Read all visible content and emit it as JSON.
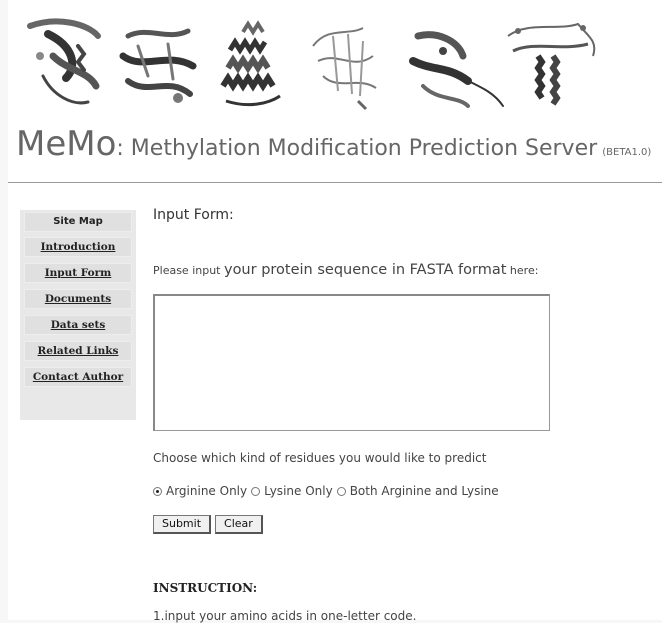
{
  "header": {
    "logo": "MeMo",
    "title_rest": ": Methylation Modification Prediction Server",
    "version": "(BETA1.0)"
  },
  "sidebar": {
    "items": [
      {
        "label": "Site Map",
        "is_heading": true
      },
      {
        "label": "Introduction"
      },
      {
        "label": "Input Form"
      },
      {
        "label": "Documents"
      },
      {
        "label": "Data sets"
      },
      {
        "label": "Related Links"
      },
      {
        "label": "Contact Author"
      }
    ]
  },
  "main": {
    "heading": "Input Form:",
    "prompt": {
      "prefix": "Please input ",
      "emphasis": "your protein sequence in FASTA format",
      "suffix": " here:"
    },
    "sequence_value": "",
    "choose_text": "Choose which kind of residues you would like to predict",
    "options": [
      {
        "label": "Arginine Only",
        "selected": true
      },
      {
        "label": "Lysine Only",
        "selected": false
      },
      {
        "label": "Both Arginine and Lysine",
        "selected": false
      }
    ],
    "submit_label": "Submit",
    "clear_label": "Clear",
    "instruction_heading": "INSTRUCTION:",
    "instruction_line1": "1.input your amino acids in one-letter code."
  }
}
